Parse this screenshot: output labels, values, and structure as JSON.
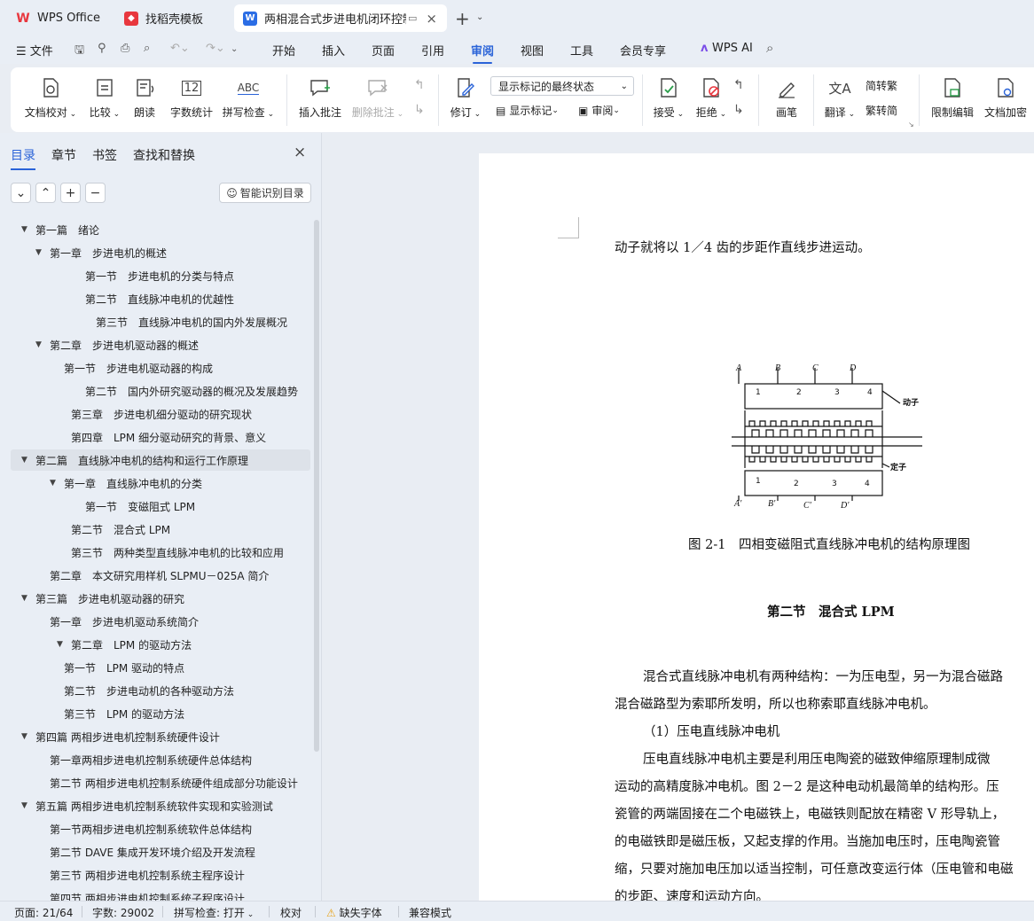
{
  "tabs": [
    {
      "label": "WPS Office",
      "icon": "wps-logo-icon"
    },
    {
      "label": "找稻壳模板",
      "icon": "docer-icon"
    },
    {
      "label": "两相混合式步进电机闭环控制",
      "icon": "writer-icon"
    }
  ],
  "menu": [
    "文件",
    "开始",
    "插入",
    "页面",
    "引用",
    "审阅",
    "视图",
    "工具",
    "会员专享",
    "WPS AI"
  ],
  "ribbon": {
    "doc_check": "文档校对",
    "compare": "比较",
    "read": "朗读",
    "word_count": "字数统计",
    "spell_check": "拼写检查",
    "insert_comment": "插入批注",
    "delete_comment": "删除批注",
    "revise": "修订",
    "markup_select": "显示标记的最终状态",
    "show_markup": "显示标记",
    "review": "审阅",
    "accept": "接受",
    "reject": "拒绝",
    "brush": "画笔",
    "translate": "翻译",
    "to_trad": "简转繁",
    "to_simp": "繁转简",
    "restrict": "限制编辑",
    "encrypt": "文档加密",
    "wc_icon_text": "12",
    "abc_text": "ABC"
  },
  "sidebar": {
    "tabs": [
      "目录",
      "章节",
      "书签",
      "查找和替换"
    ],
    "smart_toc": "智能识别目录",
    "toc": [
      {
        "label": "第一篇　绪论",
        "indent": 0,
        "arrow": true,
        "sel": false
      },
      {
        "label": "第一章　步进电机的概述",
        "indent": 1,
        "arrow": true,
        "sel": false
      },
      {
        "label": "第一节　步进电机的分类与特点",
        "indent": 4,
        "arrow": false,
        "sel": false
      },
      {
        "label": "第二节　直线脉冲电机的优越性",
        "indent": 4,
        "arrow": false,
        "sel": false
      },
      {
        "label": "第三节　直线脉冲电机的国内外发展概况",
        "indent": 5,
        "arrow": false,
        "sel": false
      },
      {
        "label": "第二章　步进电机驱动器的概述",
        "indent": 1,
        "arrow": true,
        "sel": false
      },
      {
        "label": "第一节　步进电机驱动器的构成",
        "indent": 2,
        "arrow": false,
        "sel": false
      },
      {
        "label": "第二节　国内外研究驱动器的概况及发展趋势",
        "indent": 4,
        "arrow": false,
        "sel": false
      },
      {
        "label": "第三章　步进电机细分驱动的研究现状",
        "indent": 3,
        "arrow": false,
        "sel": false
      },
      {
        "label": "第四章　LPM 细分驱动研究的背景、意义",
        "indent": 3,
        "arrow": false,
        "sel": false
      },
      {
        "label": "第二篇　直线脉冲电机的结构和运行工作原理",
        "indent": 0,
        "arrow": true,
        "sel": true
      },
      {
        "label": "第一章　直线脉冲电机的分类",
        "indent": 2,
        "arrow": true,
        "sel": false
      },
      {
        "label": "第一节　变磁阻式 LPM",
        "indent": 4,
        "arrow": false,
        "sel": false
      },
      {
        "label": "第二节　混合式 LPM",
        "indent": 3,
        "arrow": false,
        "sel": false
      },
      {
        "label": "第三节　两种类型直线脉冲电机的比较和应用",
        "indent": 3,
        "arrow": false,
        "sel": false
      },
      {
        "label": "第二章　本文研究用样机 SLPMU－025A 简介",
        "indent": 1,
        "arrow": false,
        "sel": false
      },
      {
        "label": "第三篇　步进电机驱动器的研究",
        "indent": 0,
        "arrow": true,
        "sel": false
      },
      {
        "label": "第一章　步进电机驱动系统简介",
        "indent": 1,
        "arrow": false,
        "sel": false
      },
      {
        "label": "第二章　LPM 的驱动方法",
        "indent": 3,
        "arrow": true,
        "sel": false
      },
      {
        "label": "第一节　LPM 驱动的特点",
        "indent": 2,
        "arrow": false,
        "sel": false
      },
      {
        "label": "第二节　步进电动机的各种驱动方法",
        "indent": 2,
        "arrow": false,
        "sel": false
      },
      {
        "label": "第三节　LPM 的驱动方法",
        "indent": 2,
        "arrow": false,
        "sel": false
      },
      {
        "label": "第四篇 两相步进电机控制系统硬件设计",
        "indent": 0,
        "arrow": true,
        "sel": false
      },
      {
        "label": "第一章两相步进电机控制系统硬件总体结构",
        "indent": 1,
        "arrow": false,
        "sel": false
      },
      {
        "label": "第二节 两相步进电机控制系统硬件组成部分功能设计",
        "indent": 1,
        "arrow": false,
        "sel": false
      },
      {
        "label": "第五篇 两相步进电机控制系统软件实现和实验测试",
        "indent": 0,
        "arrow": true,
        "sel": false
      },
      {
        "label": "第一节两相步进电机控制系统软件总体结构",
        "indent": 1,
        "arrow": false,
        "sel": false
      },
      {
        "label": "第二节 DAVE 集成开发环境介绍及开发流程",
        "indent": 1,
        "arrow": false,
        "sel": false
      },
      {
        "label": "第三节 两相步进电机控制系统主程序设计",
        "indent": 1,
        "arrow": false,
        "sel": false
      },
      {
        "label": "第四节 两相步进电机控制系统子程序设计",
        "indent": 1,
        "arrow": false,
        "sel": false
      }
    ]
  },
  "document": {
    "line1": "动子就将以 1／4 齿的步距作直线步进运动。",
    "figure_caption": "图 2-1　四相变磁阻式直线脉冲电机的结构原理图",
    "fig": {
      "top_letters": [
        "A",
        "B",
        "C",
        "D"
      ],
      "bottom_letters": [
        "A'",
        "B'",
        "C'",
        "D'"
      ],
      "nums": [
        "1",
        "2",
        "3",
        "4"
      ],
      "mover": "动子",
      "stator": "定子"
    },
    "section_title": "第二节　混合式 LPM",
    "para1": "混合式直线脉冲电机有两种结构：一为压电型，另一为混合磁路",
    "para1b": "混合磁路型为索耶所发明，所以也称索耶直线脉冲电机。",
    "item1": "（1）压电直线脉冲电机",
    "para2": [
      "压电直线脉冲电机主要是利用压电陶瓷的磁致伸缩原理制成微",
      "运动的高精度脉冲电机。图 2－2 是这种电动机最简单的结构形。压",
      "瓷管的两端固接在二个电磁铁上，电磁铁则配放在精密 V 形导轨上，",
      "的电磁铁即是磁压板，又起支撑的作用。当施加电压时，压电陶瓷管",
      "缩，只要对施加电压加以适当控制，可任意改变运行体（压电管和电磁",
      "的步距、速度和运动方向。"
    ]
  },
  "status": {
    "page": "页面: 21/64",
    "words": "字数: 29002",
    "spell": "拼写检查: 打开",
    "proof": "校对",
    "missing_font": "缺失字体",
    "compat": "兼容模式"
  },
  "colors": {
    "accent": "#2a63d8",
    "wps_red": "#e8373e",
    "writer_blue": "#2b6de5"
  }
}
